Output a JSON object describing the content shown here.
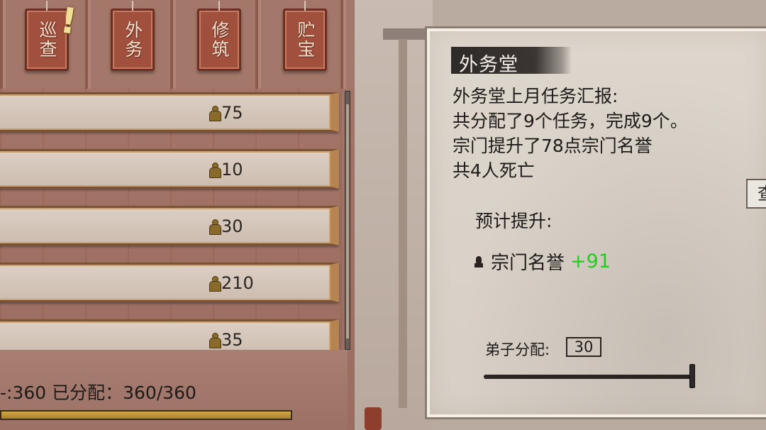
{
  "nav": {
    "alert_mark": "!",
    "plaques": [
      {
        "label": "巡查"
      },
      {
        "label": "外务"
      },
      {
        "label": "修筑"
      },
      {
        "label": "贮宝"
      }
    ]
  },
  "tasks": {
    "rows": [
      {
        "count": "75"
      },
      {
        "count": "10"
      },
      {
        "count": "30"
      },
      {
        "count": "210"
      },
      {
        "count": "35"
      }
    ]
  },
  "summary": {
    "text": "-:360 已分配：360/360",
    "progress_fraction": 1.0
  },
  "panel": {
    "title": "外务堂",
    "report": [
      "外务堂上月任务汇报:",
      "共分配了9个任务，完成9个。",
      "宗门提升了78点宗门名誉",
      "共4人死亡"
    ],
    "side_button_label": "查",
    "predict_label": "预计提升:",
    "reputation": {
      "label": "宗门名誉",
      "value": "+91"
    },
    "assign": {
      "label": "弟子分配:",
      "value": "30",
      "slider_fraction": 1.0
    }
  },
  "colors": {
    "positive": "#1fcd1f",
    "plaque": "#a2503e",
    "panel_bg": "#ddd6cc"
  }
}
